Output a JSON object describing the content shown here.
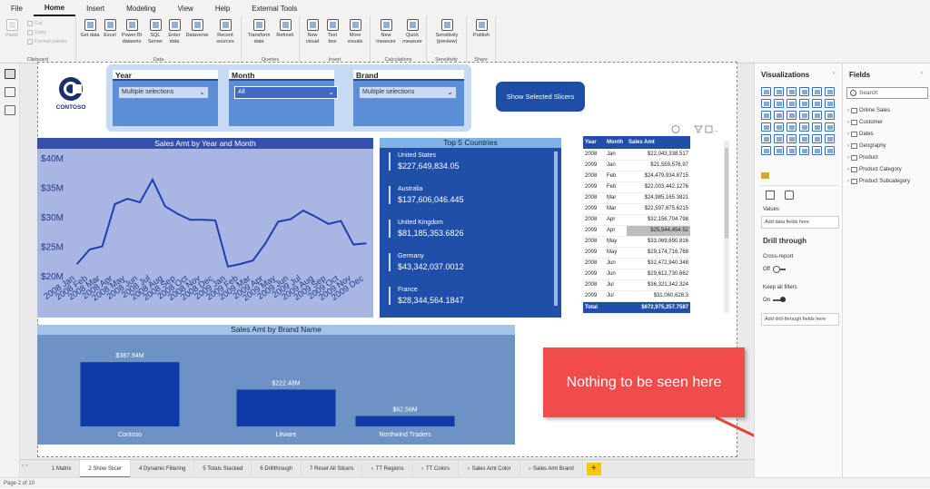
{
  "menu": [
    "File",
    "Home",
    "Insert",
    "Modeling",
    "View",
    "Help",
    "External Tools"
  ],
  "ribbon": {
    "clipboard": {
      "paste": "Paste",
      "cut": "Cut",
      "copy": "Copy",
      "format_painter": "Format painter",
      "label": "Clipboard"
    },
    "data": {
      "buttons": [
        "Get data",
        "Excel",
        "Power BI datasets",
        "SQL Server",
        "Enter data",
        "Dataverse",
        "Recent sources"
      ],
      "label": "Data"
    },
    "queries": {
      "buttons": [
        "Transform data",
        "Refresh"
      ],
      "label": "Queries"
    },
    "insert": {
      "buttons": [
        "New visual",
        "Text box",
        "More visuals"
      ],
      "label": "Insert"
    },
    "calculations": {
      "buttons": [
        "New measure",
        "Quick measure"
      ],
      "label": "Calculations"
    },
    "sensitivity": {
      "buttons": [
        "Sensitivity (preview)"
      ],
      "label": "Sensitivity"
    },
    "share": {
      "buttons": [
        "Publish"
      ],
      "label": "Share"
    }
  },
  "logo": {
    "text": "CONTOSO"
  },
  "slicers": [
    {
      "title": "Year",
      "value": "Multiple selections"
    },
    {
      "title": "Month",
      "value": "All"
    },
    {
      "title": "Brand",
      "value": "Multiple selections"
    }
  ],
  "show_button": "Show Selected Slicers",
  "line_chart_title": "Sales Amt by Year and Month",
  "top5": {
    "title": "Top 5 Countries",
    "items": [
      {
        "name": "United States",
        "value": "$227,649,834.05"
      },
      {
        "name": "Australia",
        "value": "$137,606,046.445"
      },
      {
        "name": "United Kingdom",
        "value": "$81,185,353.6826"
      },
      {
        "name": "Germany",
        "value": "$43,342,037.0012"
      },
      {
        "name": "France",
        "value": "$28,344,564.1847"
      }
    ]
  },
  "table": {
    "headers": [
      "Year",
      "Month",
      "Sales Amt"
    ],
    "rows": [
      [
        "2008",
        "Jan",
        "$22,043,338.517"
      ],
      [
        "2009",
        "Jan",
        "$21,559,576.97"
      ],
      [
        "2008",
        "Feb",
        "$24,479,934.8715"
      ],
      [
        "2009",
        "Feb",
        "$22,003,442.1276"
      ],
      [
        "2008",
        "Mar",
        "$24,985,165.3821"
      ],
      [
        "2009",
        "Mar",
        "$22,597,675.6215"
      ],
      [
        "2008",
        "Apr",
        "$32,156,704.798"
      ],
      [
        "2009",
        "Apr",
        "$25,544,454.52"
      ],
      [
        "2008",
        "May",
        "$33,069,690.816"
      ],
      [
        "2009",
        "May",
        "$29,174,716.768"
      ],
      [
        "2008",
        "Jun",
        "$32,472,940.348"
      ],
      [
        "2009",
        "Jun",
        "$29,612,730.662"
      ],
      [
        "2008",
        "Jul",
        "$36,321,342.324"
      ],
      [
        "2009",
        "Jul",
        "$31,060,628.3"
      ]
    ],
    "highlight_row": 7,
    "total_label": "Total",
    "total_value": "$672,975,257.7587"
  },
  "bar_chart_title": "Sales Amt by Brand Name",
  "callout": "Nothing to be seen here",
  "tabs": [
    "1 Matrix",
    "2 Show Slicer",
    "4 Dynamic Filtering",
    "5 Totals Stacked",
    "6 Drillthrough",
    "7 Reset All Slicers",
    "TT Regions",
    "TT Colors",
    "Sales Amt Color",
    "Sales Amt Brand"
  ],
  "active_tab": 1,
  "status": "Page 2 of 10",
  "visualizations": {
    "title": "Visualizations",
    "values_label": "Values",
    "add_data_fields": "Add data fields here",
    "drill_through": "Drill through",
    "cross_report": "Cross-report",
    "cross_report_state": "Off",
    "keep_all_filters": "Keep all filters",
    "keep_all_filters_state": "On",
    "add_drill_fields": "Add drill-through fields here"
  },
  "fields": {
    "title": "Fields",
    "search_placeholder": "Search",
    "tables": [
      "Online Sales",
      "Customer",
      "Dates",
      "Geography",
      "Product",
      "Product Category",
      "Product Subcategory"
    ]
  },
  "chart_data": [
    {
      "type": "line",
      "title": "Sales Amt by Year and Month",
      "ylabel": "",
      "xlabel": "",
      "x": [
        "2008 Jan",
        "2008 Feb",
        "2008 Mar",
        "2008 Apr",
        "2008 May",
        "2008 Jun",
        "2008 Jul",
        "2008 Aug",
        "2008 Sep",
        "2008 Oct",
        "2008 Nov",
        "2008 Dec",
        "2009 Jan",
        "2009 Feb",
        "2009 Mar",
        "2009 Apr",
        "2009 May",
        "2009 Jun",
        "2009 Jul",
        "2009 Aug",
        "2009 Sep",
        "2009 Oct",
        "2009 Nov",
        "2009 Dec"
      ],
      "values": [
        22.04,
        24.48,
        24.99,
        32.16,
        33.07,
        32.47,
        36.32,
        31.8,
        30.5,
        29.5,
        29.5,
        29.4,
        21.56,
        22.0,
        22.6,
        25.54,
        29.17,
        29.61,
        31.06,
        30.0,
        28.8,
        29.3,
        25.3,
        25.5
      ],
      "y_ticks": [
        "$20M",
        "$25M",
        "$30M",
        "$35M",
        "$40M"
      ],
      "ylim": [
        20,
        40
      ],
      "grid": false,
      "legend": "none"
    },
    {
      "type": "bar",
      "title": "Sales Amt by Brand Name",
      "categories": [
        "Contoso",
        "Litware",
        "Northwind Traders"
      ],
      "values": [
        387.94,
        222.48,
        62.56
      ],
      "labels": [
        "$387.94M",
        "$222.48M",
        "$62.56M"
      ],
      "ylim": [
        0,
        400
      ],
      "grid": false,
      "legend": "none"
    }
  ]
}
